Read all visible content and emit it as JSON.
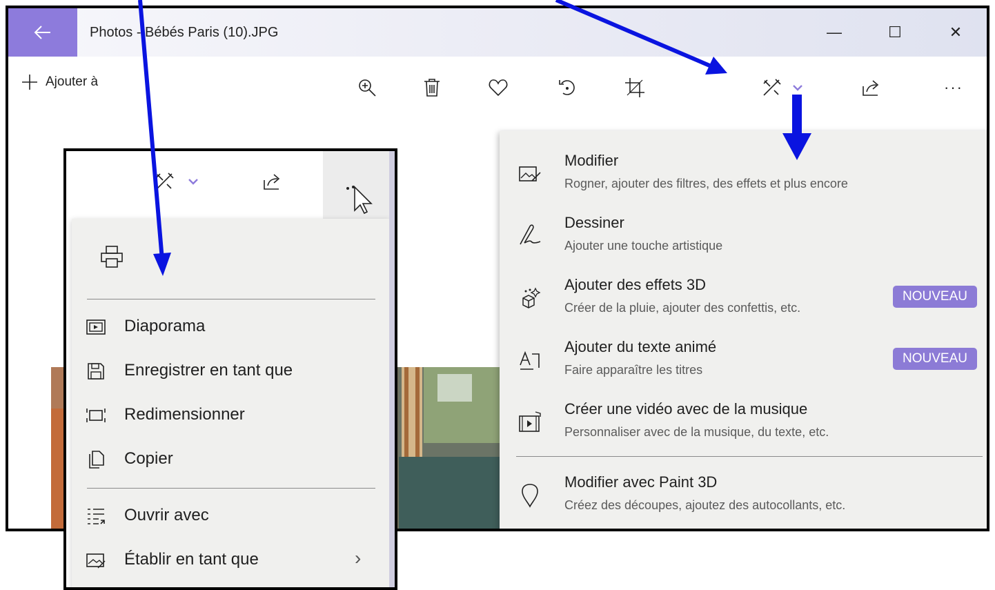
{
  "window": {
    "title": "Photos - Bébés Paris (10).JPG",
    "controls": {
      "minimize": "—",
      "maximize": "☐",
      "close": "✕"
    }
  },
  "toolbar": {
    "add_to_label": "Ajouter à",
    "icons": [
      "zoom-in-icon",
      "delete-icon",
      "favorite-heart-icon",
      "rotate-icon",
      "crop-icon",
      "edit-create-icon",
      "share-icon",
      "more-icon"
    ],
    "more_label": "···"
  },
  "edit_menu": {
    "items": [
      {
        "title": "Modifier",
        "subtitle": "Rogner, ajouter des filtres, des effets et plus encore",
        "icon": "edit-photo-icon"
      },
      {
        "title": "Dessiner",
        "subtitle": "Ajouter une touche artistique",
        "icon": "draw-pen-icon"
      },
      {
        "title": "Ajouter des effets 3D",
        "subtitle": "Créer de la pluie, ajouter des confettis, etc.",
        "icon": "effects-3d-icon",
        "badge": "NOUVEAU"
      },
      {
        "title": "Ajouter du texte animé",
        "subtitle": "Faire apparaître les titres",
        "icon": "animated-text-icon",
        "badge": "NOUVEAU"
      },
      {
        "title": "Créer une vidéo avec de la musique",
        "subtitle": "Personnaliser avec de la musique, du texte, etc.",
        "icon": "video-music-icon"
      },
      {
        "title": "Modifier avec Paint 3D",
        "subtitle": "Créez des découpes, ajoutez des autocollants, etc.",
        "icon": "paint-3d-icon"
      }
    ],
    "badge_color": "#8c7bd6"
  },
  "more_menu": {
    "print_icon": "print-icon",
    "items": [
      {
        "label": "Diaporama",
        "icon": "slideshow-icon"
      },
      {
        "label": "Enregistrer en tant que",
        "icon": "save-icon"
      },
      {
        "label": "Redimensionner",
        "icon": "resize-icon"
      },
      {
        "label": "Copier",
        "icon": "copy-icon"
      },
      {
        "label": "Ouvrir avec",
        "icon": "open-with-icon"
      },
      {
        "label": "Établir en tant que",
        "icon": "set-as-icon",
        "chevron": "›"
      }
    ]
  },
  "colors": {
    "accent": "#8d7bdc",
    "annotation_arrow": "#0a14e0"
  }
}
